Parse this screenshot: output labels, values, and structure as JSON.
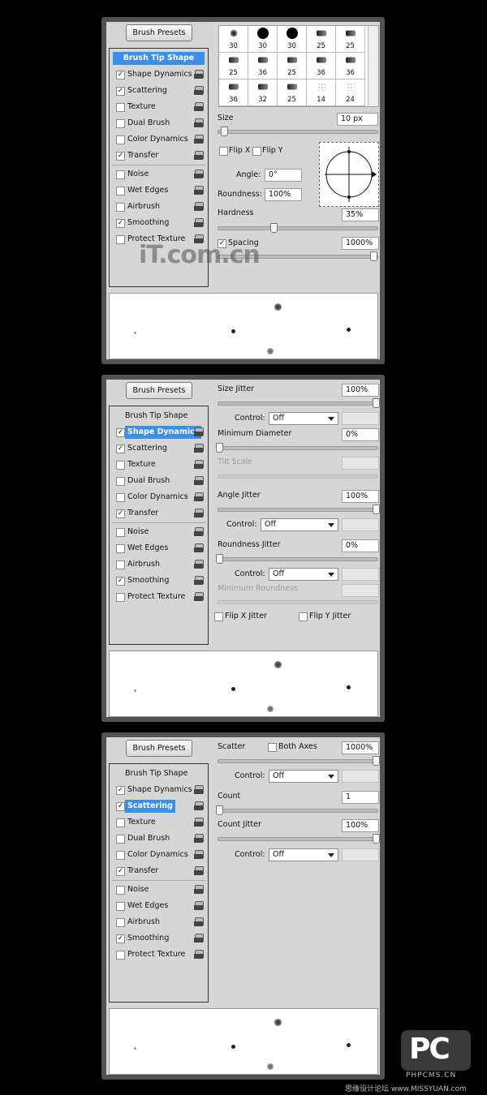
{
  "left_items": [
    {
      "label": "Brush Tip Shape",
      "type": "tip"
    },
    {
      "label": "Shape Dynamics",
      "type": "item"
    },
    {
      "label": "Scattering",
      "type": "item"
    },
    {
      "label": "Texture",
      "type": "item"
    },
    {
      "label": "Dual Brush",
      "type": "item"
    },
    {
      "label": "Color Dynamics",
      "type": "item"
    },
    {
      "label": "Transfer",
      "type": "item"
    },
    {
      "label": "Noise",
      "type": "item"
    },
    {
      "label": "Wet Edges",
      "type": "item"
    },
    {
      "label": "Airbrush",
      "type": "item"
    },
    {
      "label": "Smoothing",
      "type": "item"
    },
    {
      "label": "Protect Texture",
      "type": "item"
    }
  ],
  "panel1": {
    "presets_button": "Brush Presets",
    "checked": [
      false,
      true,
      true,
      false,
      false,
      false,
      true,
      false,
      false,
      false,
      true,
      false
    ],
    "selected": 0,
    "brush_grid": [
      {
        "n": "30",
        "icon": "soft-round-brush-icon"
      },
      {
        "n": "30",
        "icon": "hard-round-brush-icon"
      },
      {
        "n": "30",
        "icon": "hard-round-brush-icon"
      },
      {
        "n": "25",
        "icon": "pencil-brush-icon"
      },
      {
        "n": "25",
        "icon": "chalk-brush-icon"
      },
      {
        "n": "25",
        "icon": "flat-brush-icon"
      },
      {
        "n": "36",
        "icon": "flat-brush-icon"
      },
      {
        "n": "25",
        "icon": "fan-brush-icon"
      },
      {
        "n": "36",
        "icon": "chalk-brush-icon"
      },
      {
        "n": "36",
        "icon": "chalk-brush-icon"
      },
      {
        "n": "36",
        "icon": "flat-brush-icon"
      },
      {
        "n": "32",
        "icon": "flat-brush-icon"
      },
      {
        "n": "25",
        "icon": "fan-brush-icon"
      },
      {
        "n": "14",
        "icon": "star-brush-icon"
      },
      {
        "n": "24",
        "icon": "scatter-brush-icon"
      }
    ],
    "size_label": "Size",
    "size_value": "10 px",
    "size_level": 0.03,
    "flip_x": "Flip X",
    "flip_y": "Flip Y",
    "angle_label": "Angle:",
    "angle_value": "0°",
    "roundness_label": "Roundness:",
    "roundness_value": "100%",
    "hardness_label": "Hardness",
    "hardness_value": "35%",
    "hardness_level": 0.35,
    "spacing_label": "Spacing",
    "spacing_value": "1000%",
    "spacing_level": 1.0,
    "watermark": "iT.com.cn"
  },
  "panel2": {
    "presets_button": "Brush Presets",
    "checked": [
      false,
      true,
      true,
      false,
      false,
      false,
      true,
      false,
      false,
      false,
      true,
      false
    ],
    "selected": 1,
    "size_jitter_label": "Size Jitter",
    "size_jitter_value": "100%",
    "control_label": "Control:",
    "control_value": "Off",
    "min_diameter_label": "Minimum Diameter",
    "min_diameter_value": "0%",
    "tilt_scale_label": "Tilt Scale",
    "angle_jitter_label": "Angle Jitter",
    "angle_jitter_value": "100%",
    "roundness_jitter_label": "Roundness Jitter",
    "roundness_jitter_value": "0%",
    "min_roundness_label": "Minimum Roundness",
    "flip_x_jitter": "Flip X Jitter",
    "flip_y_jitter": "Flip Y Jitter"
  },
  "panel3": {
    "presets_button": "Brush Presets",
    "checked": [
      false,
      true,
      true,
      false,
      false,
      false,
      true,
      false,
      false,
      false,
      true,
      false
    ],
    "selected": 2,
    "scatter_label": "Scatter",
    "both_axes_label": "Both Axes",
    "scatter_value": "1000%",
    "control_label": "Control:",
    "control_value": "Off",
    "count_label": "Count",
    "count_value": "1",
    "count_jitter_label": "Count Jitter",
    "count_jitter_value": "100%"
  },
  "logo": {
    "text": "PC",
    "site": "PHPCMS.CN",
    "footer": "思缘设计论坛 www.MISSYUAN.com"
  }
}
